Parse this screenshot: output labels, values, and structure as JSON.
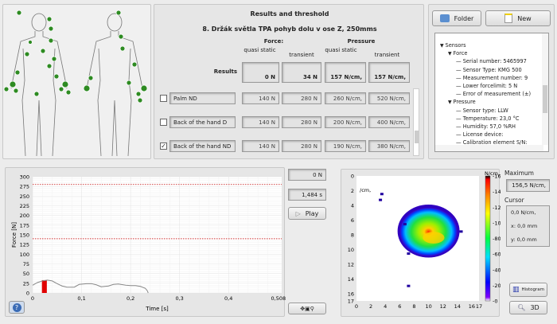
{
  "results": {
    "title": "Results and threshold",
    "subtitle": "8. Držák světla TPA pohyb dolu v ose Z, 250mms",
    "force_label": "Force:",
    "pressure_label": "Pressure",
    "col_qs": "quasi static",
    "col_tr": "transient",
    "results_label": "Results",
    "results_values": [
      "0 N",
      "34 N",
      "157 N/cm,",
      "157 N/cm,"
    ],
    "rows": [
      {
        "name": "Palm ND",
        "checked": false,
        "values": [
          "140 N",
          "280 N",
          "260 N/cm,",
          "520 N/cm,"
        ]
      },
      {
        "name": "Back of the hand D",
        "checked": false,
        "values": [
          "140 N",
          "280 N",
          "200 N/cm,",
          "400 N/cm,"
        ]
      },
      {
        "name": "Back of the hand ND",
        "checked": true,
        "values": [
          "140 N",
          "280 N",
          "190 N/cm,",
          "380 N/cm,"
        ]
      }
    ]
  },
  "toolbar": {
    "folder": "Folder",
    "new": "New"
  },
  "tree": [
    "Sensors",
    "Force",
    "Serial number: 5465997",
    "Sensor Type: KMG 500",
    "Measurement number: 9",
    "Lower forcelimit: 5 N",
    "Error of measurement (±)",
    "Pressure",
    "Sensor type: LLW",
    "Temperature: 23,0 °C",
    "Humidity: 57,0 %RH",
    "License device:",
    "Calibration element S/N:"
  ],
  "playback": {
    "force": "0 N",
    "time": "1,484 s",
    "play": "Play"
  },
  "pressure_panel": {
    "max_label": "Maximum",
    "max_value": "156,5 N/cm,",
    "cursor_label": "Cursor",
    "cursor_value": "0,0 N/cm,",
    "cursor_x": "x: 0,0 mm",
    "cursor_y": "y: 0,0 mm",
    "histogram": "Histogram",
    "btn3d": "3D",
    "unit": "N/cm,",
    "axis_unit": "/cm,"
  },
  "chart_data": [
    {
      "type": "line",
      "xlabel": "Time [s]",
      "ylabel": "Force [N]",
      "xlim": [
        0,
        0.50847
      ],
      "ylim": [
        0,
        300
      ],
      "xticks": [
        "0",
        "0,1",
        "0,2",
        "0,3",
        "0,4",
        "0,50847"
      ],
      "yticks": [
        "0",
        "25",
        "50",
        "75",
        "100",
        "125",
        "150",
        "175",
        "200",
        "225",
        "250",
        "275",
        "300"
      ],
      "thresholds": [
        280,
        140
      ],
      "cursor_range": [
        0.019,
        0.029
      ],
      "cursor_value": 33,
      "series": [
        {
          "name": "force",
          "x": [
            0,
            0.01,
            0.02,
            0.03,
            0.04,
            0.05,
            0.06,
            0.07,
            0.085,
            0.095,
            0.11,
            0.12,
            0.13,
            0.14,
            0.155,
            0.165,
            0.175,
            0.19,
            0.2,
            0.21,
            0.22,
            0.23,
            0.234,
            0.236
          ],
          "y": [
            20,
            27,
            31,
            33,
            31,
            24,
            18,
            15,
            15,
            22,
            24,
            24,
            21,
            16,
            18,
            22,
            23,
            20,
            19,
            19,
            17,
            12,
            6,
            0
          ]
        }
      ]
    },
    {
      "type": "heatmap",
      "xlim": [
        0,
        17
      ],
      "ylim": [
        0,
        17
      ],
      "xticks": [
        "0",
        "2",
        "4",
        "6",
        "8",
        "10",
        "12",
        "14",
        "16",
        "17"
      ],
      "yticks": [
        "0",
        "2",
        "4",
        "6",
        "8",
        "10",
        "12",
        "14",
        "16",
        "17"
      ],
      "colorbar_ticks": [
        "0",
        "20",
        "40",
        "60",
        "80",
        "100",
        "120",
        "140",
        "160"
      ],
      "peak_center": [
        10.5,
        8.3
      ]
    }
  ]
}
